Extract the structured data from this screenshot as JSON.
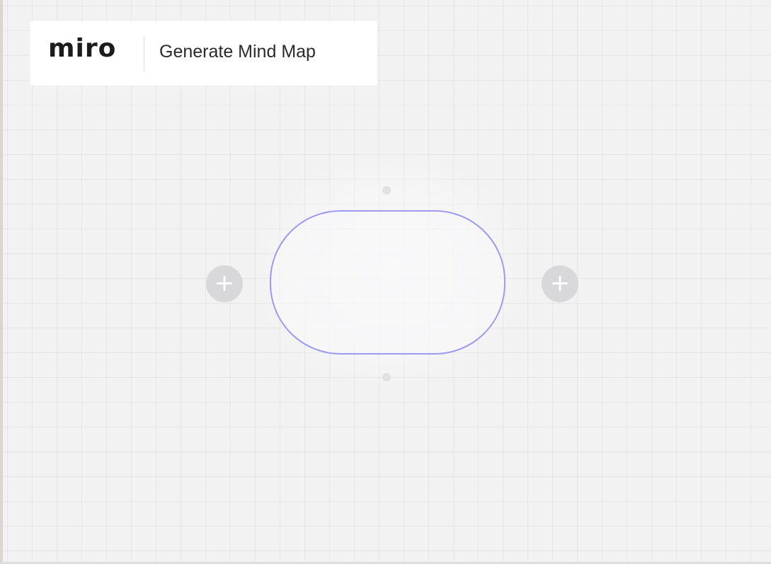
{
  "header": {
    "logo_text": "miro",
    "title": "Generate Mind Map"
  },
  "mind_map": {
    "root_node_text": "",
    "add_left_symbol": "+",
    "add_right_symbol": "+"
  },
  "colors": {
    "node_border": "#9d9af0",
    "canvas_background": "#f2f2f3",
    "add_button": "#d8d8da"
  }
}
